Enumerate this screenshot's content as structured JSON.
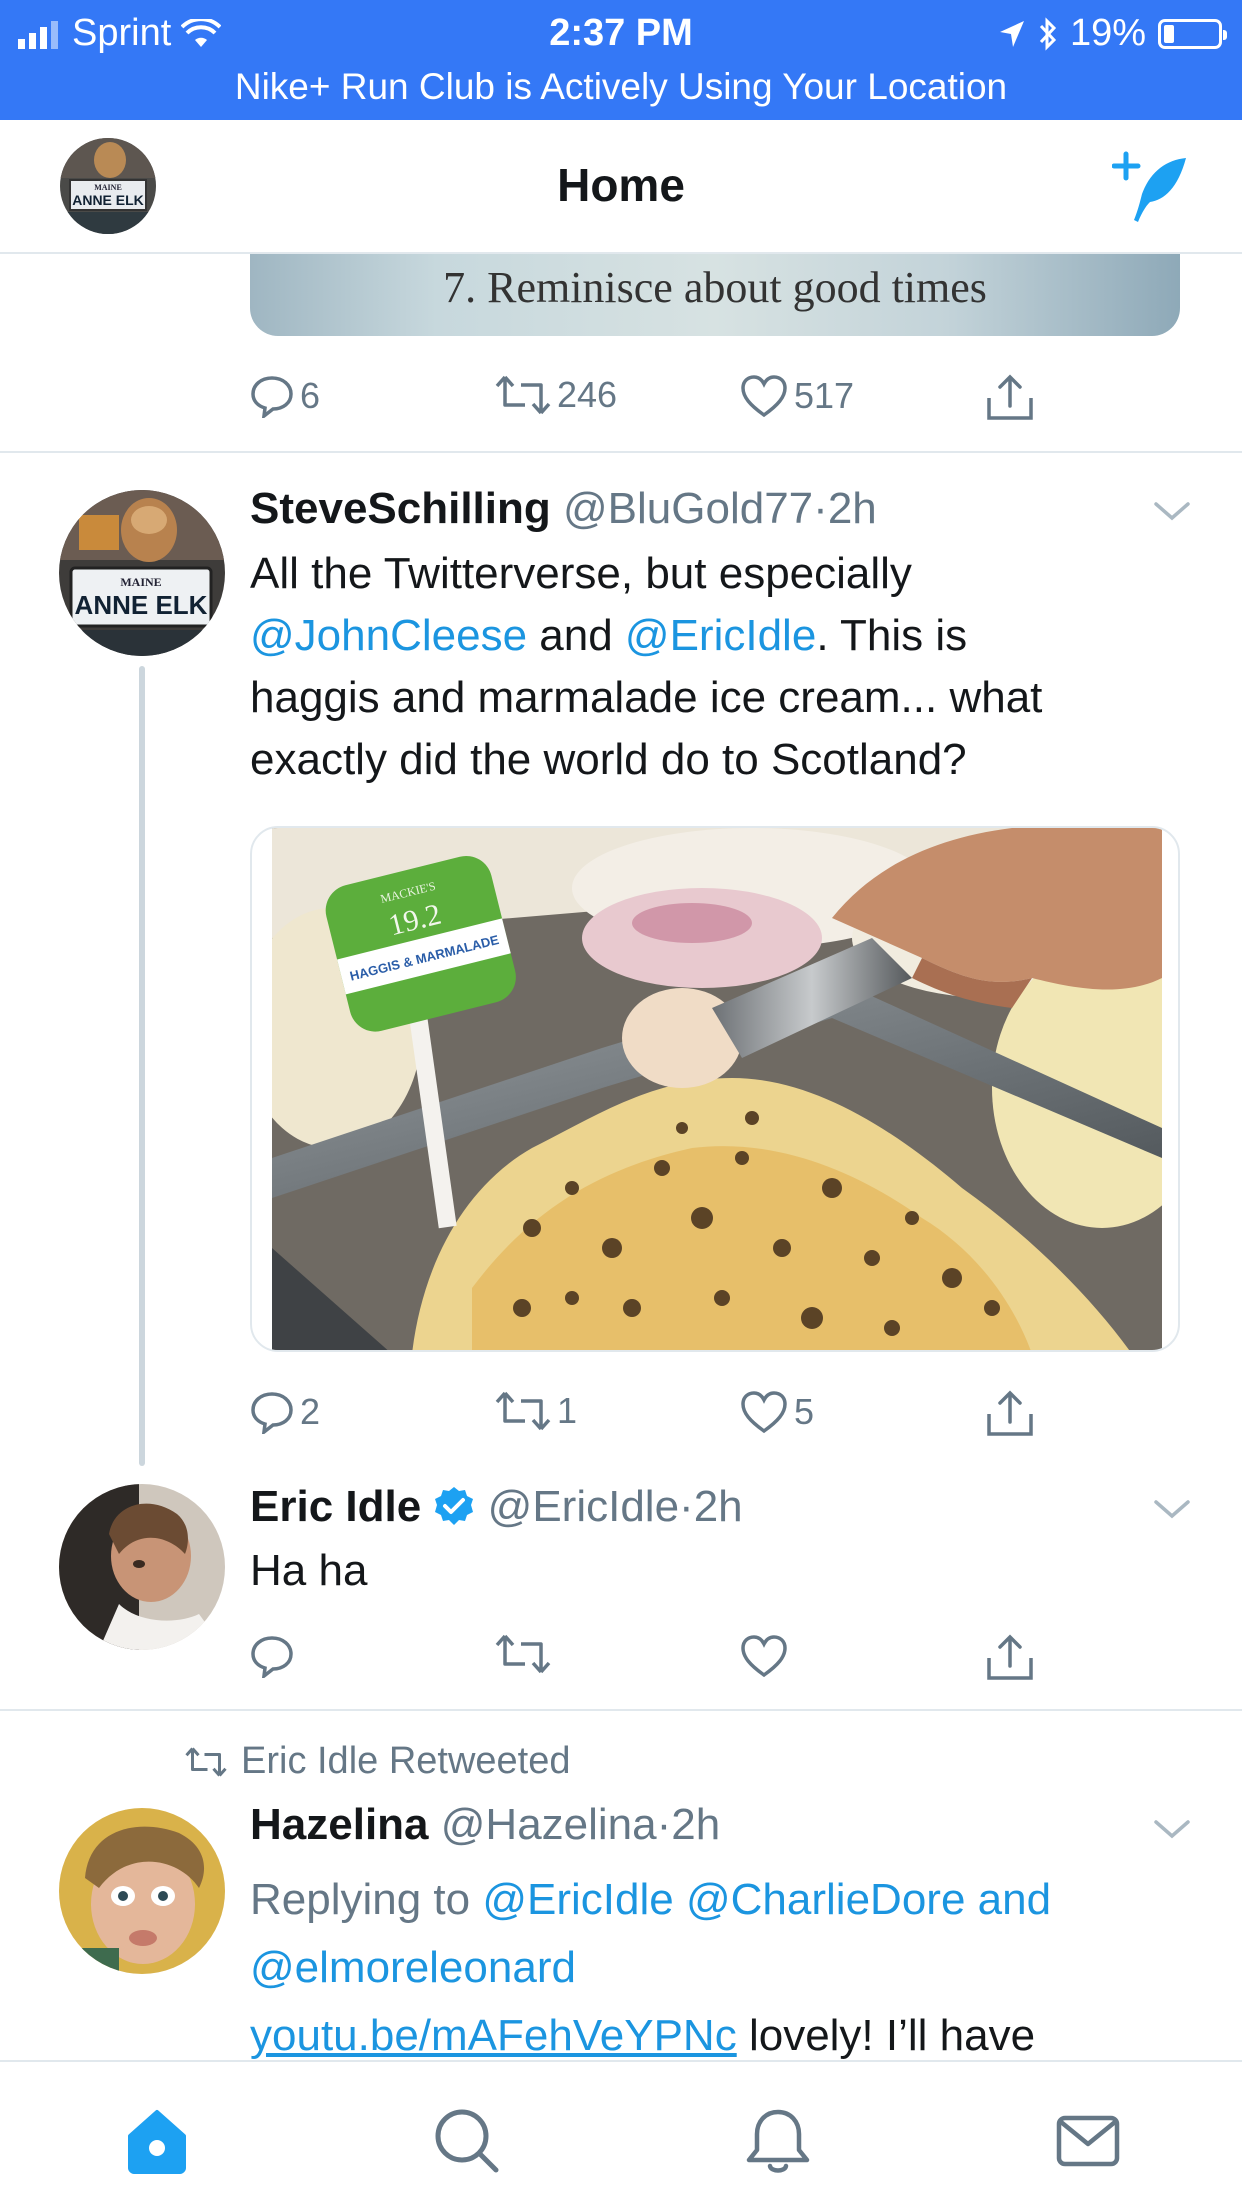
{
  "status_bar": {
    "carrier": "Sprint",
    "time": "2:37 PM",
    "battery": "19%",
    "battery_level": 0.19,
    "banner": "Nike+ Run Club is Actively Using Your Location"
  },
  "header": {
    "title": "Home",
    "avatar_plate_state": "MAINE",
    "avatar_plate_text": "ANNE ELK"
  },
  "tweets": [
    {
      "image_caption": "7. Reminisce about good times",
      "replies": "6",
      "retweets": "246",
      "likes": "517"
    },
    {
      "name": "SteveSchilling",
      "handle": "@BluGold77",
      "time": "2h",
      "text_line1": "All the Twitterverse, but especially",
      "mention1": "@JohnCleese",
      "and": " and ",
      "mention2": "@EricIdle",
      "text_rest": ". This is",
      "text_line3": "haggis and marmalade ice cream... what",
      "text_line4": "exactly did the world do to Scotland?",
      "avatar_plate_state": "MAINE",
      "avatar_plate_text": "ANNE ELK",
      "image_label_brand": "MACKIE'S",
      "image_label_number": "19.2",
      "image_label_flavor": "HAGGIS & MARMALADE",
      "replies": "2",
      "retweets": "1",
      "likes": "5"
    },
    {
      "name": "Eric Idle",
      "verified": true,
      "handle": "@EricIdle",
      "time": "2h",
      "text": "Ha ha"
    },
    {
      "retweeted_by": "Eric Idle Retweeted",
      "name": "Hazelina",
      "handle": "@Hazelina",
      "time": "2h",
      "reply_prefix": "Replying to ",
      "reply_to1": "@EricIdle",
      "reply_to2": "@CharlieDore",
      "reply_and": "and",
      "reply_to3": "@elmoreleonard",
      "link": "youtu.be/mAFehVeYPNc",
      "text_after_link": " lovely! I’ll have"
    }
  ],
  "tab_bar": {
    "tabs": [
      "home-icon",
      "search-icon",
      "notifications-icon",
      "messages-icon"
    ]
  },
  "colors": {
    "status_bar": "#3478f6",
    "accent": "#1da1f2",
    "link": "#1b95e0",
    "muted": "#657786"
  }
}
